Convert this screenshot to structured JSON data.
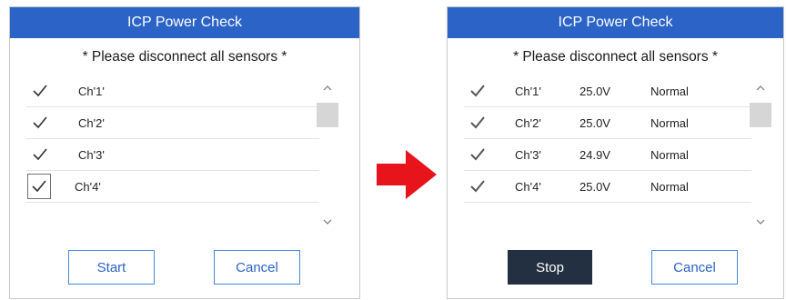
{
  "left_dialog": {
    "title": "ICP Power Check",
    "notice": "* Please disconnect all sensors *",
    "rows": [
      {
        "channel": "Ch'1'",
        "checked": true
      },
      {
        "channel": "Ch'2'",
        "checked": true
      },
      {
        "channel": "Ch'3'",
        "checked": true
      },
      {
        "channel": "Ch'4'",
        "checked": true
      }
    ],
    "start_label": "Start",
    "cancel_label": "Cancel"
  },
  "right_dialog": {
    "title": "ICP Power Check",
    "notice": "* Please disconnect all sensors *",
    "rows": [
      {
        "channel": "Ch'1'",
        "voltage": "25.0V",
        "status": "Normal",
        "checked": true
      },
      {
        "channel": "Ch'2'",
        "voltage": "25.0V",
        "status": "Normal",
        "checked": true
      },
      {
        "channel": "Ch'3'",
        "voltage": "24.9V",
        "status": "Normal",
        "checked": true
      },
      {
        "channel": "Ch'4'",
        "voltage": "25.0V",
        "status": "Normal",
        "checked": true
      }
    ],
    "stop_label": "Stop",
    "cancel_label": "Cancel"
  },
  "icons": {
    "transition": "right-arrow-icon",
    "checkbox": "checkmark-icon",
    "scroll_up": "chevron-up-icon",
    "scroll_down": "chevron-down-icon"
  },
  "colors": {
    "title_bar": "#2b63c6",
    "button_border": "#4a86d6",
    "stop_button": "#233042",
    "arrow": "#e8141b"
  }
}
